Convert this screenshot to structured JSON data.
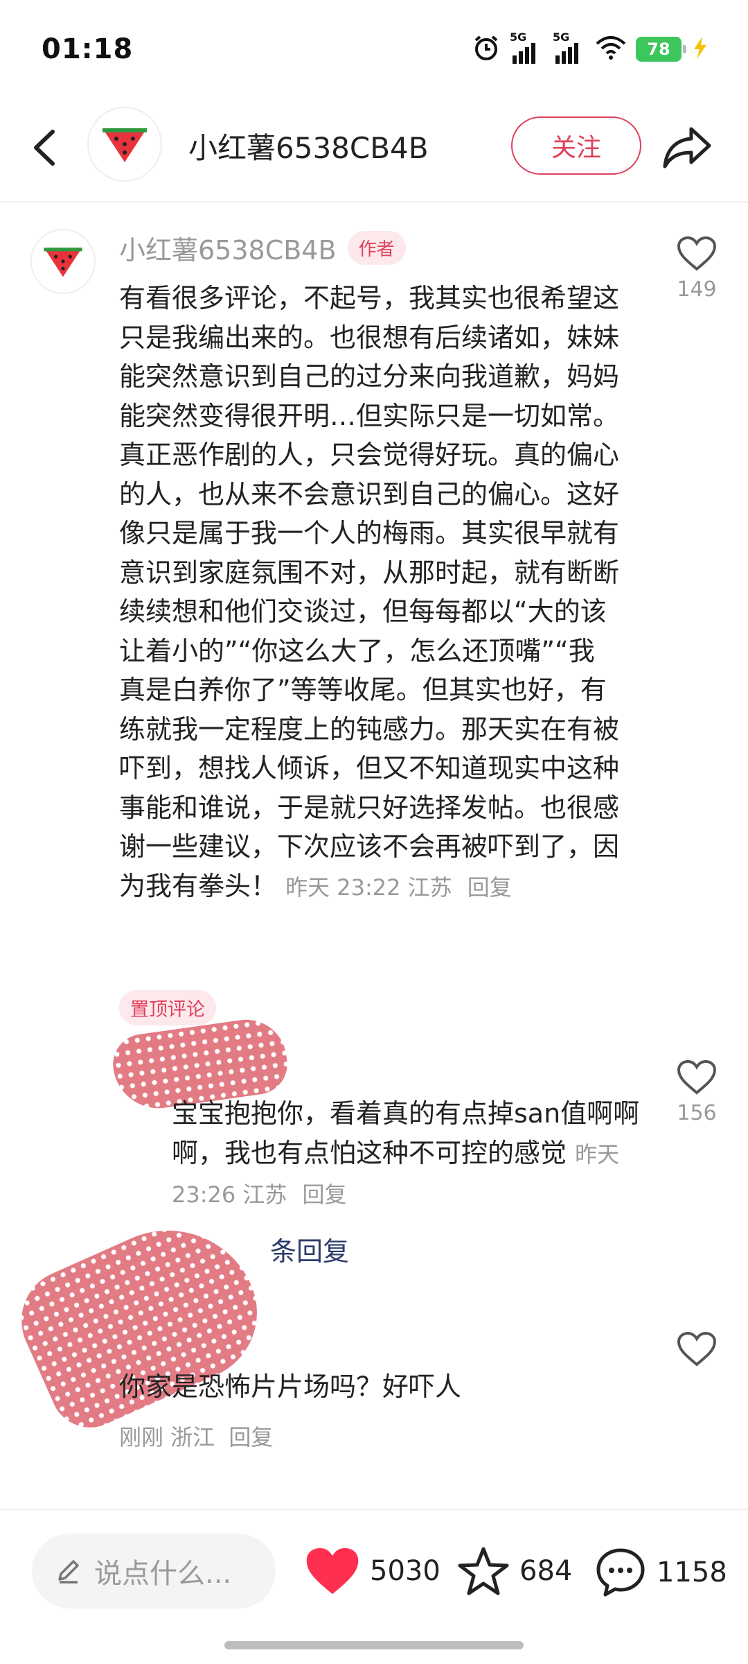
{
  "status_bar": {
    "time": "01:18",
    "signal_1_label": "5G",
    "signal_2_label": "5G",
    "battery": "78",
    "icons": [
      "alarm-icon",
      "signal-icon",
      "signal-icon",
      "wifi-icon",
      "battery-icon",
      "charging-icon"
    ]
  },
  "header": {
    "username": "小红薯6538CB4B",
    "follow_label": "关注",
    "avatar_icon": "watermelon-icon"
  },
  "author_comment": {
    "author": "小红薯6538CB4B",
    "author_tag": "作者",
    "text": "有看很多评论，不起号，我其实也很希望这只是我编出来的。也很想有后续诸如，妹妹能突然意识到自己的过分来向我道歉，妈妈能突然变得很开明…但实际只是一切如常。真正恶作剧的人，只会觉得好玩。真的偏心的人，也从来不会意识到自己的偏心。这好像只是属于我一个人的梅雨。其实很早就有意识到家庭氛围不对，从那时起，就有断断续续想和他们交谈过，但每每都以“大的该让着小的”“你这么大了，怎么还顶嘴”“我真是白养你了”等等收尾。但其实也好，有练就我一定程度上的钝感力。那天实在有被吓到，想找人倾诉，但又不知道现实中这种事能和谁说，于是就只好选择发帖。也很感谢一些建议，下次应该不会再被吓到了，因为我有拳头！",
    "time_location": "昨天 23:22 江苏",
    "reply_label": "回复",
    "pin_tag": "置顶评论",
    "likes": "149"
  },
  "reply_comment": {
    "text": "宝宝抱抱你，看着真的有点掉san值啊啊啊，我也有点怕这种不可控的感觉",
    "time_location": "昨天 23:26 江苏",
    "reply_label": "回复",
    "likes": "156"
  },
  "expand_replies": {
    "label": "条回复"
  },
  "third_comment": {
    "text": "你家是恐怖片片场吗？好吓人",
    "time_location": "刚刚 浙江",
    "reply_label": "回复"
  },
  "bottom_bar": {
    "input_placeholder": "说点什么...",
    "likes": "5030",
    "favorites": "684",
    "comments": "1158",
    "like_color": "#ff2f4f"
  }
}
